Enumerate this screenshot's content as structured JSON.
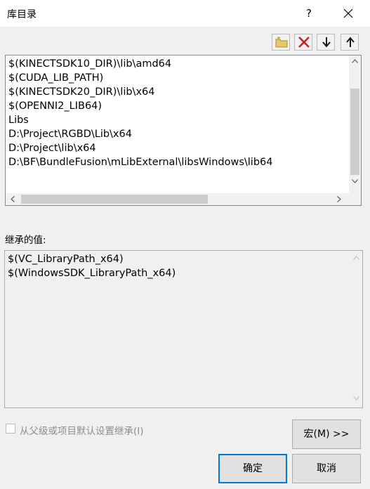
{
  "window": {
    "title": "库目录",
    "help": "?"
  },
  "toolbar": [
    "new-folder-icon",
    "delete-icon",
    "move-down-icon",
    "move-up-icon"
  ],
  "list": {
    "items": [
      "$(KINECTSDK10_DIR)\\lib\\amd64",
      "$(CUDA_LIB_PATH)",
      "$(KINECTSDK20_DIR)\\lib\\x64",
      "$(OPENNI2_LIB64)",
      "Libs",
      "D:\\Project\\RGBD\\Lib\\x64",
      "D:\\Project\\lib\\x64",
      "D:\\BF\\BundleFusion\\mLibExternal\\libsWindows\\lib64"
    ]
  },
  "inherited": {
    "label": "继承的值:",
    "items": [
      "$(VC_LibraryPath_x64)",
      "$(WindowsSDK_LibraryPath_x64)"
    ]
  },
  "inherit_checkbox": {
    "label": "从父级或项目默认设置继承(I)",
    "checked": false
  },
  "buttons": {
    "macro": "宏(M) >>",
    "ok": "确定",
    "cancel": "取消"
  },
  "colors": {
    "accent": "#0078d7",
    "delete": "#c81e1e"
  }
}
